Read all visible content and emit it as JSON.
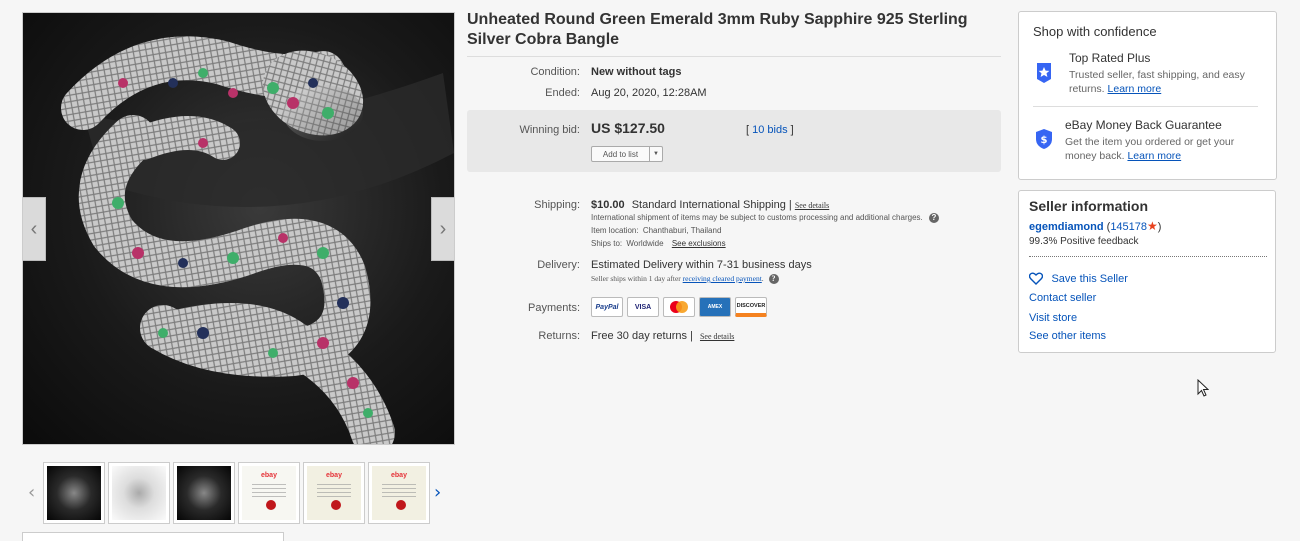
{
  "listing": {
    "title": "Unheated Round Green Emerald 3mm Ruby Sapphire 925 Sterling Silver Cobra Bangle",
    "condition_label": "Condition:",
    "condition_value": "New without tags",
    "ended_label": "Ended:",
    "ended_value": "Aug 20, 2020, 12:28AM",
    "winning_bid_label": "Winning bid:",
    "winning_bid_value": "US $127.50",
    "bids_open": "[",
    "bids_text": "10 bids",
    "bids_close": "]",
    "add_to_list_label": "Add to list"
  },
  "shipping": {
    "label": "Shipping:",
    "cost": "$10.00",
    "method": "Standard International Shipping |",
    "see_details": "See details",
    "customs_note": "International shipment of items may be subject to customs processing and additional charges.",
    "location_label": "Item location:",
    "location_value": "Chanthaburi, Thailand",
    "ships_to_label": "Ships to:",
    "ships_to_value": "Worldwide",
    "see_exclusions": "See exclusions"
  },
  "delivery": {
    "label": "Delivery:",
    "estimate": "Estimated Delivery within 7-31 business days",
    "note_prefix": "Seller ships within 1 day after",
    "note_link": "receiving cleared payment",
    "note_suffix": "."
  },
  "payments": {
    "label": "Payments:",
    "methods": [
      "PayPal",
      "VISA",
      "MasterCard",
      "AMEX",
      "DISCOVER"
    ]
  },
  "returns": {
    "label": "Returns:",
    "value": "Free 30 day returns |",
    "see_details": "See details"
  },
  "confidence": {
    "heading": "Shop with confidence",
    "top_rated_title": "Top Rated Plus",
    "top_rated_text": "Trusted seller, fast shipping, and easy returns.",
    "top_rated_link": "Learn more",
    "guarantee_title": "eBay Money Back Guarantee",
    "guarantee_text": "Get the item you ordered or get your money back.",
    "guarantee_link": "Learn more"
  },
  "seller": {
    "heading": "Seller information",
    "name": "egemdiamond",
    "score_open": "(",
    "score": "145178",
    "score_close": ")",
    "feedback": "99.3% Positive feedback",
    "save_seller": "Save this Seller",
    "contact": "Contact seller",
    "visit_store": "Visit store",
    "other_items": "See other items"
  },
  "icons": {
    "prev": "chevron-left-icon",
    "next": "chevron-right-icon",
    "heart": "heart-icon",
    "star": "star-icon",
    "shield": "shield-icon",
    "help": "help-icon",
    "cursor": "mouse-pointer-icon"
  },
  "colors": {
    "link": "#0654ba",
    "bid_box": "#e8e8e8",
    "rating_star": "#e8411e"
  }
}
